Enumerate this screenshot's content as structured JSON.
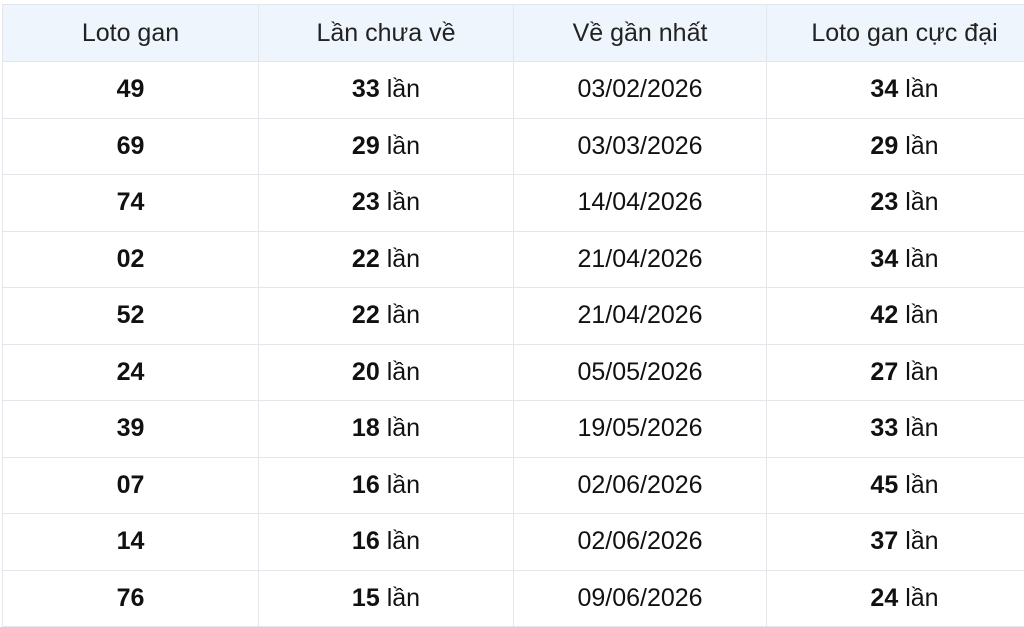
{
  "colors": {
    "header_bg": "#eef5fc",
    "date_text": "#2f5aa8",
    "border": "#e3e6ea"
  },
  "headers": [
    "Loto gan",
    "Lần chưa về",
    "Về gần nhất",
    "Loto gan cực đại"
  ],
  "unit_label": "lần",
  "rows": [
    {
      "loto": "49",
      "missed": "33",
      "last_date": "03/02/2026",
      "max_gan": "34"
    },
    {
      "loto": "69",
      "missed": "29",
      "last_date": "03/03/2026",
      "max_gan": "29"
    },
    {
      "loto": "74",
      "missed": "23",
      "last_date": "14/04/2026",
      "max_gan": "23"
    },
    {
      "loto": "02",
      "missed": "22",
      "last_date": "21/04/2026",
      "max_gan": "34"
    },
    {
      "loto": "52",
      "missed": "22",
      "last_date": "21/04/2026",
      "max_gan": "42"
    },
    {
      "loto": "24",
      "missed": "20",
      "last_date": "05/05/2026",
      "max_gan": "27"
    },
    {
      "loto": "39",
      "missed": "18",
      "last_date": "19/05/2026",
      "max_gan": "33"
    },
    {
      "loto": "07",
      "missed": "16",
      "last_date": "02/06/2026",
      "max_gan": "45"
    },
    {
      "loto": "14",
      "missed": "16",
      "last_date": "02/06/2026",
      "max_gan": "37"
    },
    {
      "loto": "76",
      "missed": "15",
      "last_date": "09/06/2026",
      "max_gan": "24"
    }
  ]
}
